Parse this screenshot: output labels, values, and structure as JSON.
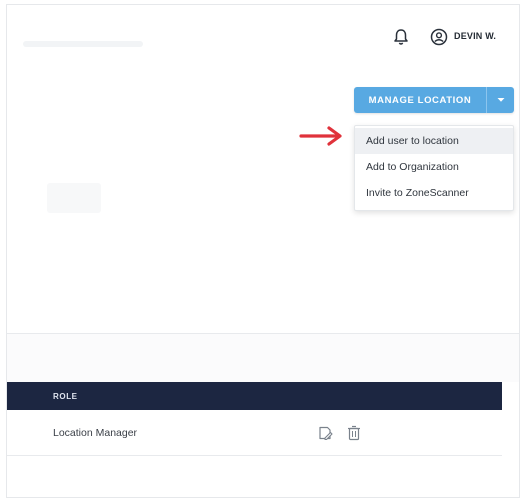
{
  "header": {
    "username": "DEVIN W.",
    "icons": [
      "bell-icon",
      "user-circle-icon"
    ]
  },
  "actions": {
    "manage_location_label": "MANAGE LOCATION",
    "caret_icon": "chevron-down-icon",
    "menu": [
      {
        "label": "Add user to location",
        "highlighted": true
      },
      {
        "label": "Add to Organization",
        "highlighted": false
      },
      {
        "label": "Invite to ZoneScanner",
        "highlighted": false
      }
    ]
  },
  "annotation": {
    "icon": "right-arrow-icon",
    "color": "#e0323b"
  },
  "table": {
    "columns": [
      "ROLE"
    ],
    "rows": [
      {
        "role": "Location Manager",
        "actions": [
          "edit-icon",
          "delete-icon"
        ]
      }
    ]
  },
  "colors": {
    "accent": "#58a9e2",
    "table_header": "#1c2641"
  }
}
